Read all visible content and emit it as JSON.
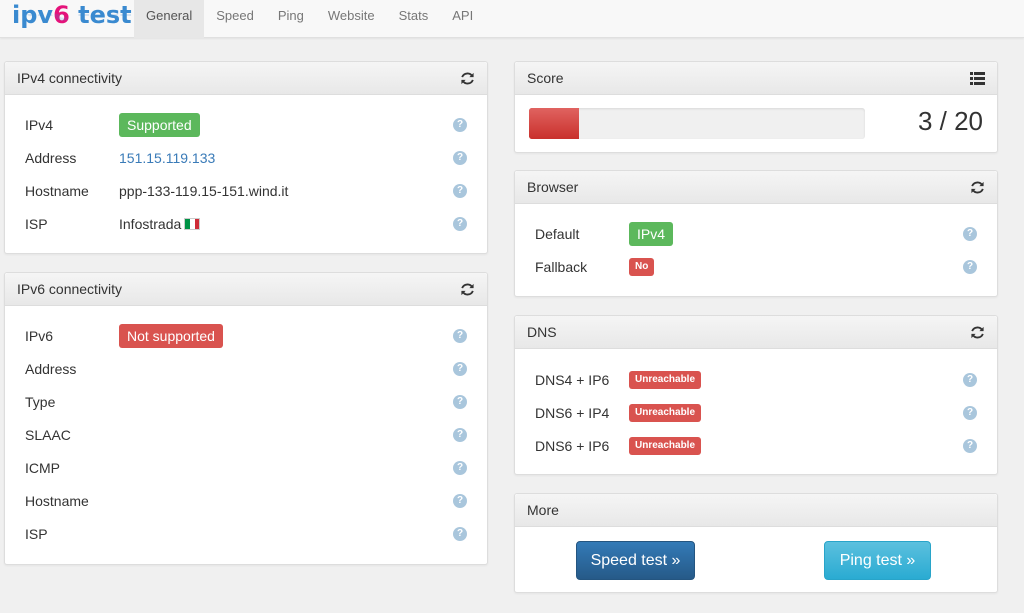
{
  "brand": {
    "part1": "ipv",
    "part2": "6",
    "part3": " test"
  },
  "nav": [
    "General",
    "Speed",
    "Ping",
    "Website",
    "Stats",
    "API"
  ],
  "ipv4": {
    "title": "IPv4 connectivity",
    "rows": [
      {
        "label": "IPv4",
        "value": "Supported"
      },
      {
        "label": "Address",
        "value": "151.15.119.133"
      },
      {
        "label": "Hostname",
        "value": "ppp-133-119.15-151.wind.it"
      },
      {
        "label": "ISP",
        "value": "Infostrada"
      }
    ]
  },
  "ipv6": {
    "title": "IPv6 connectivity",
    "rows": [
      {
        "label": "IPv6",
        "value": "Not supported"
      },
      {
        "label": "Address",
        "value": ""
      },
      {
        "label": "Type",
        "value": ""
      },
      {
        "label": "SLAAC",
        "value": ""
      },
      {
        "label": "ICMP",
        "value": ""
      },
      {
        "label": "Hostname",
        "value": ""
      },
      {
        "label": "ISP",
        "value": ""
      }
    ]
  },
  "score": {
    "title": "Score",
    "text": "3 / 20",
    "fraction": 0.15
  },
  "browser": {
    "title": "Browser",
    "rows": [
      {
        "label": "Default",
        "value": "IPv4"
      },
      {
        "label": "Fallback",
        "value": "No"
      }
    ]
  },
  "dns": {
    "title": "DNS",
    "rows": [
      {
        "label": "DNS4 + IP6",
        "value": "Unreachable"
      },
      {
        "label": "DNS6 + IP4",
        "value": "Unreachable"
      },
      {
        "label": "DNS6 + IP6",
        "value": "Unreachable"
      }
    ]
  },
  "more": {
    "title": "More",
    "speed_button": "Speed test »",
    "ping_button": "Ping test »"
  },
  "help_glyph": "?",
  "colors": {
    "success": "#5cb85c",
    "danger": "#d9534f",
    "link": "#3a7bb8",
    "primary": "#337ab7",
    "info": "#5bc0de"
  },
  "icons": {
    "refresh": "refresh-icon",
    "list": "list-icon",
    "flag": "italy-flag-icon"
  }
}
